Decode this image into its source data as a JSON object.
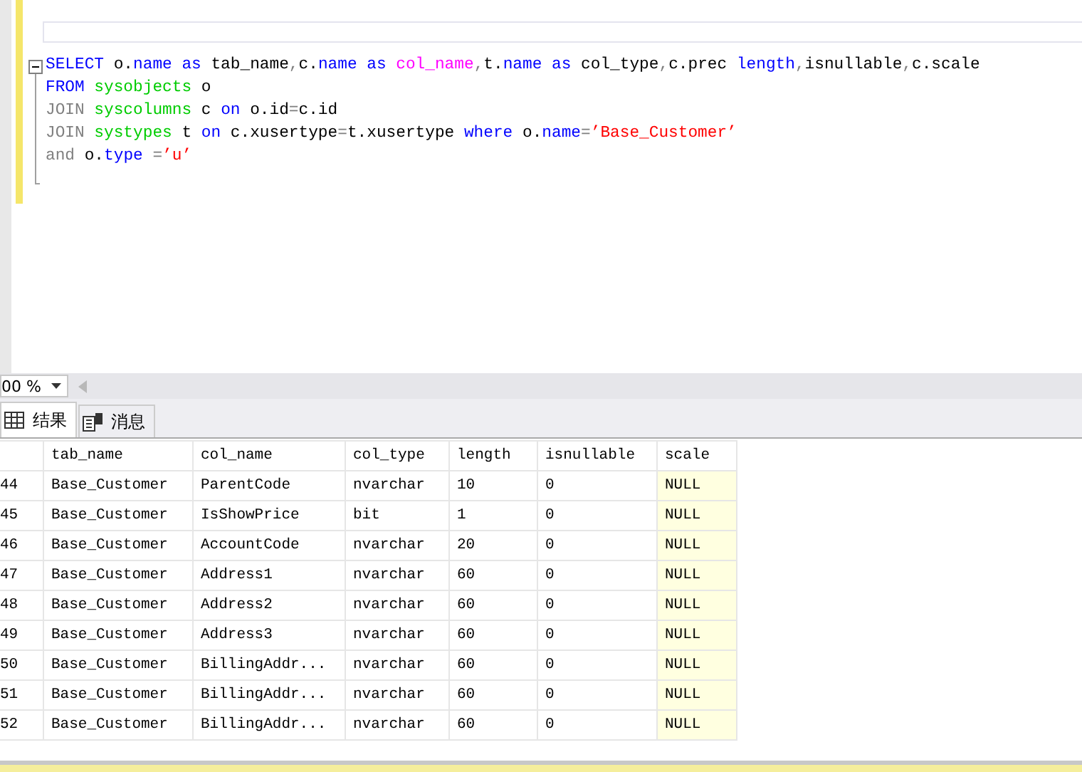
{
  "editor": {
    "lines": [
      {
        "tokens": [
          {
            "kind": "keyword",
            "text": "SELECT"
          },
          {
            "kind": "plain",
            "text": " o."
          },
          {
            "kind": "keyword",
            "text": "name"
          },
          {
            "kind": "keyword",
            "text": " as"
          },
          {
            "kind": "plain",
            "text": " tab_name"
          },
          {
            "kind": "operator",
            "text": ","
          },
          {
            "kind": "plain",
            "text": "c."
          },
          {
            "kind": "keyword",
            "text": "name"
          },
          {
            "kind": "keyword",
            "text": " as"
          },
          {
            "kind": "function",
            "text": " col_name"
          },
          {
            "kind": "operator",
            "text": ","
          },
          {
            "kind": "plain",
            "text": "t."
          },
          {
            "kind": "keyword",
            "text": "name"
          },
          {
            "kind": "keyword",
            "text": " as"
          },
          {
            "kind": "plain",
            "text": " col_type"
          },
          {
            "kind": "operator",
            "text": ","
          },
          {
            "kind": "plain",
            "text": "c.prec "
          },
          {
            "kind": "keyword",
            "text": "length"
          },
          {
            "kind": "operator",
            "text": ","
          },
          {
            "kind": "plain",
            "text": "isnullable"
          },
          {
            "kind": "operator",
            "text": ","
          },
          {
            "kind": "plain",
            "text": "c.scale"
          }
        ]
      },
      {
        "tokens": [
          {
            "kind": "keyword",
            "text": "FROM"
          },
          {
            "kind": "system",
            "text": " sysobjects"
          },
          {
            "kind": "plain",
            "text": " o"
          }
        ]
      },
      {
        "tokens": [
          {
            "kind": "operator",
            "text": "JOIN"
          },
          {
            "kind": "system",
            "text": " syscolumns"
          },
          {
            "kind": "plain",
            "text": " c "
          },
          {
            "kind": "keyword",
            "text": "on"
          },
          {
            "kind": "plain",
            "text": " o.id"
          },
          {
            "kind": "operator",
            "text": "="
          },
          {
            "kind": "plain",
            "text": "c.id"
          }
        ]
      },
      {
        "tokens": [
          {
            "kind": "operator",
            "text": "JOIN"
          },
          {
            "kind": "system",
            "text": " systypes"
          },
          {
            "kind": "plain",
            "text": " t "
          },
          {
            "kind": "keyword",
            "text": "on"
          },
          {
            "kind": "plain",
            "text": " c.xusertype"
          },
          {
            "kind": "operator",
            "text": "="
          },
          {
            "kind": "plain",
            "text": "t.xusertype "
          },
          {
            "kind": "keyword",
            "text": "where"
          },
          {
            "kind": "plain",
            "text": " o."
          },
          {
            "kind": "keyword",
            "text": "name"
          },
          {
            "kind": "operator",
            "text": "="
          },
          {
            "kind": "string",
            "text": "’Base_Customer’"
          }
        ]
      },
      {
        "tokens": [
          {
            "kind": "operator",
            "text": "and"
          },
          {
            "kind": "plain",
            "text": " o."
          },
          {
            "kind": "keyword",
            "text": "type"
          },
          {
            "kind": "operator",
            "text": " ="
          },
          {
            "kind": "string",
            "text": "’u’"
          }
        ]
      }
    ]
  },
  "zoom": {
    "value": "00 %"
  },
  "tabs": [
    {
      "label": "结果",
      "selected": true,
      "kind": "grid"
    },
    {
      "label": "消息",
      "selected": false,
      "kind": "message"
    }
  ],
  "table": {
    "columns": [
      "tab_name",
      "col_name",
      "col_type",
      "length",
      "isnullable",
      "scale"
    ],
    "rows": [
      {
        "row_number": "44",
        "cells": [
          "Base_Customer",
          "ParentCode",
          "nvarchar",
          "10",
          "0",
          "NULL"
        ]
      },
      {
        "row_number": "45",
        "cells": [
          "Base_Customer",
          "IsShowPrice",
          "bit",
          "1",
          "0",
          "NULL"
        ]
      },
      {
        "row_number": "46",
        "cells": [
          "Base_Customer",
          "AccountCode",
          "nvarchar",
          "20",
          "0",
          "NULL"
        ]
      },
      {
        "row_number": "47",
        "cells": [
          "Base_Customer",
          "Address1",
          "nvarchar",
          "60",
          "0",
          "NULL"
        ]
      },
      {
        "row_number": "48",
        "cells": [
          "Base_Customer",
          "Address2",
          "nvarchar",
          "60",
          "0",
          "NULL"
        ]
      },
      {
        "row_number": "49",
        "cells": [
          "Base_Customer",
          "Address3",
          "nvarchar",
          "60",
          "0",
          "NULL"
        ]
      },
      {
        "row_number": "50",
        "cells": [
          "Base_Customer",
          "BillingAddr...",
          "nvarchar",
          "60",
          "0",
          "NULL"
        ]
      },
      {
        "row_number": "51",
        "cells": [
          "Base_Customer",
          "BillingAddr...",
          "nvarchar",
          "60",
          "0",
          "NULL"
        ]
      },
      {
        "row_number": "52",
        "cells": [
          "Base_Customer",
          "BillingAddr...",
          "nvarchar",
          "60",
          "0",
          "NULL"
        ]
      }
    ]
  }
}
